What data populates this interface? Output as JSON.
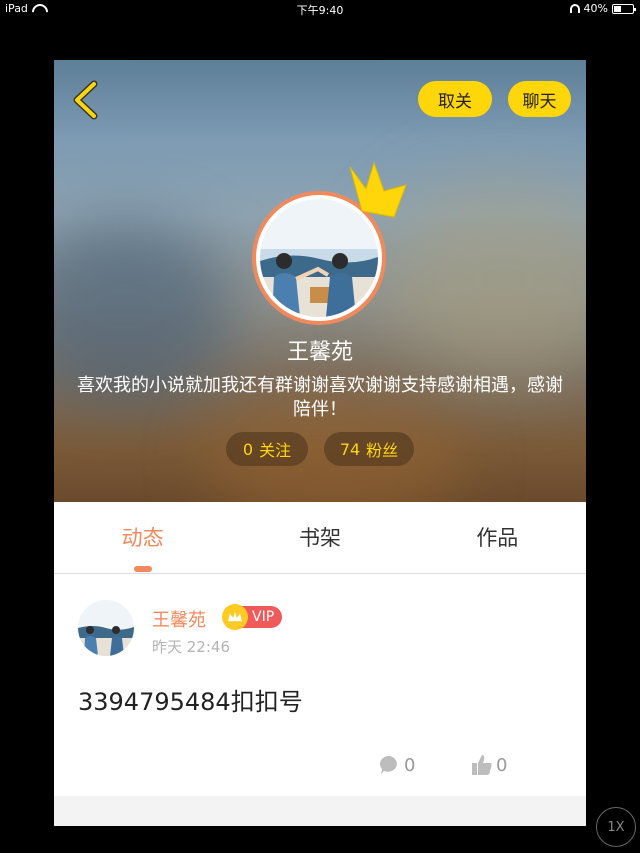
{
  "status_bar": {
    "device": "iPad",
    "time": "下午9:40",
    "battery": "40%",
    "battery_level": 0.4
  },
  "header": {
    "back_icon": "chevron-left-icon",
    "unfollow_label": "取关",
    "chat_label": "聊天"
  },
  "profile": {
    "name": "王馨苑",
    "bio": "喜欢我的小说就加我还有群谢谢喜欢谢谢支持感谢相遇，感谢陪伴！",
    "following_count": "0",
    "following_label": "关注",
    "fans_count": "74",
    "fans_label": "粉丝",
    "crown_icon": "crown-icon"
  },
  "tabs": [
    {
      "label": "动态",
      "active": true
    },
    {
      "label": "书架",
      "active": false
    },
    {
      "label": "作品",
      "active": false
    }
  ],
  "post": {
    "author": "王馨苑",
    "vip_label": "VIP",
    "time": "昨天 22:46",
    "text": "3394795484扣扣号",
    "comment_count": "0",
    "like_count": "0"
  },
  "zoom_label": "1X",
  "colors": {
    "accent": "#f08a5d",
    "yellow": "#ffd60a",
    "vip_red": "#f05a5a"
  }
}
